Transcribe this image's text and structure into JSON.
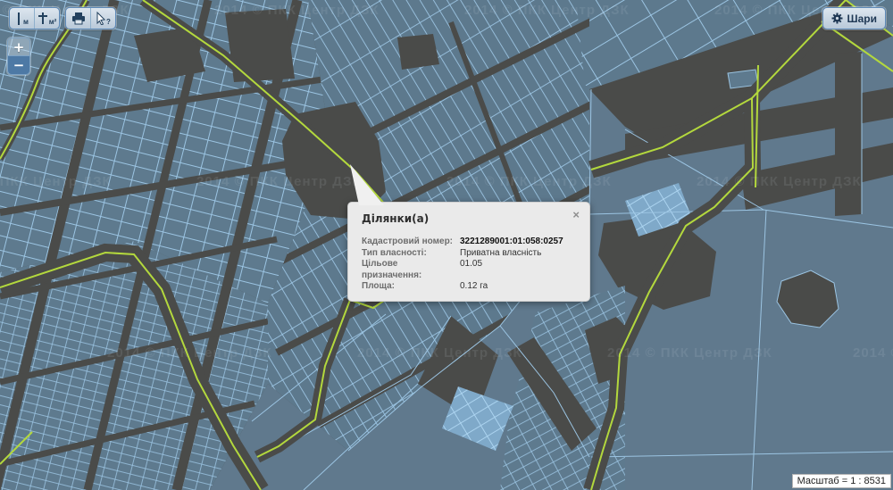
{
  "toolbar": {
    "measure_length_unit": "м",
    "measure_area_unit": "м²",
    "identify_mark": "?"
  },
  "zoom_control": {
    "zoom_in": "+",
    "zoom_out": "−"
  },
  "layers_button": {
    "label": "Шари"
  },
  "popup": {
    "title": "Ділянки(а)",
    "close": "×",
    "fields": [
      {
        "label": "Кадастровий номер:",
        "value": "3221289001:01:058:0257"
      },
      {
        "label": "Тип власності:",
        "value": "Приватна власність"
      },
      {
        "label": "Цільове призначення:",
        "value": "01.05"
      },
      {
        "label": "Площа:",
        "value": "0.12 га"
      }
    ]
  },
  "scale_bar": {
    "text": "Масштаб = 1 : 8531"
  },
  "map": {
    "watermark_tile": "2014 © ПКК  Центр ДЗК",
    "colors": {
      "background": "#4a4b49",
      "parcel_fill": "#5e7a8e",
      "parcel_outline": "#9bc4e2",
      "road_line": "#b3d83d",
      "highlight_parcel": "#7fa9c9"
    }
  }
}
